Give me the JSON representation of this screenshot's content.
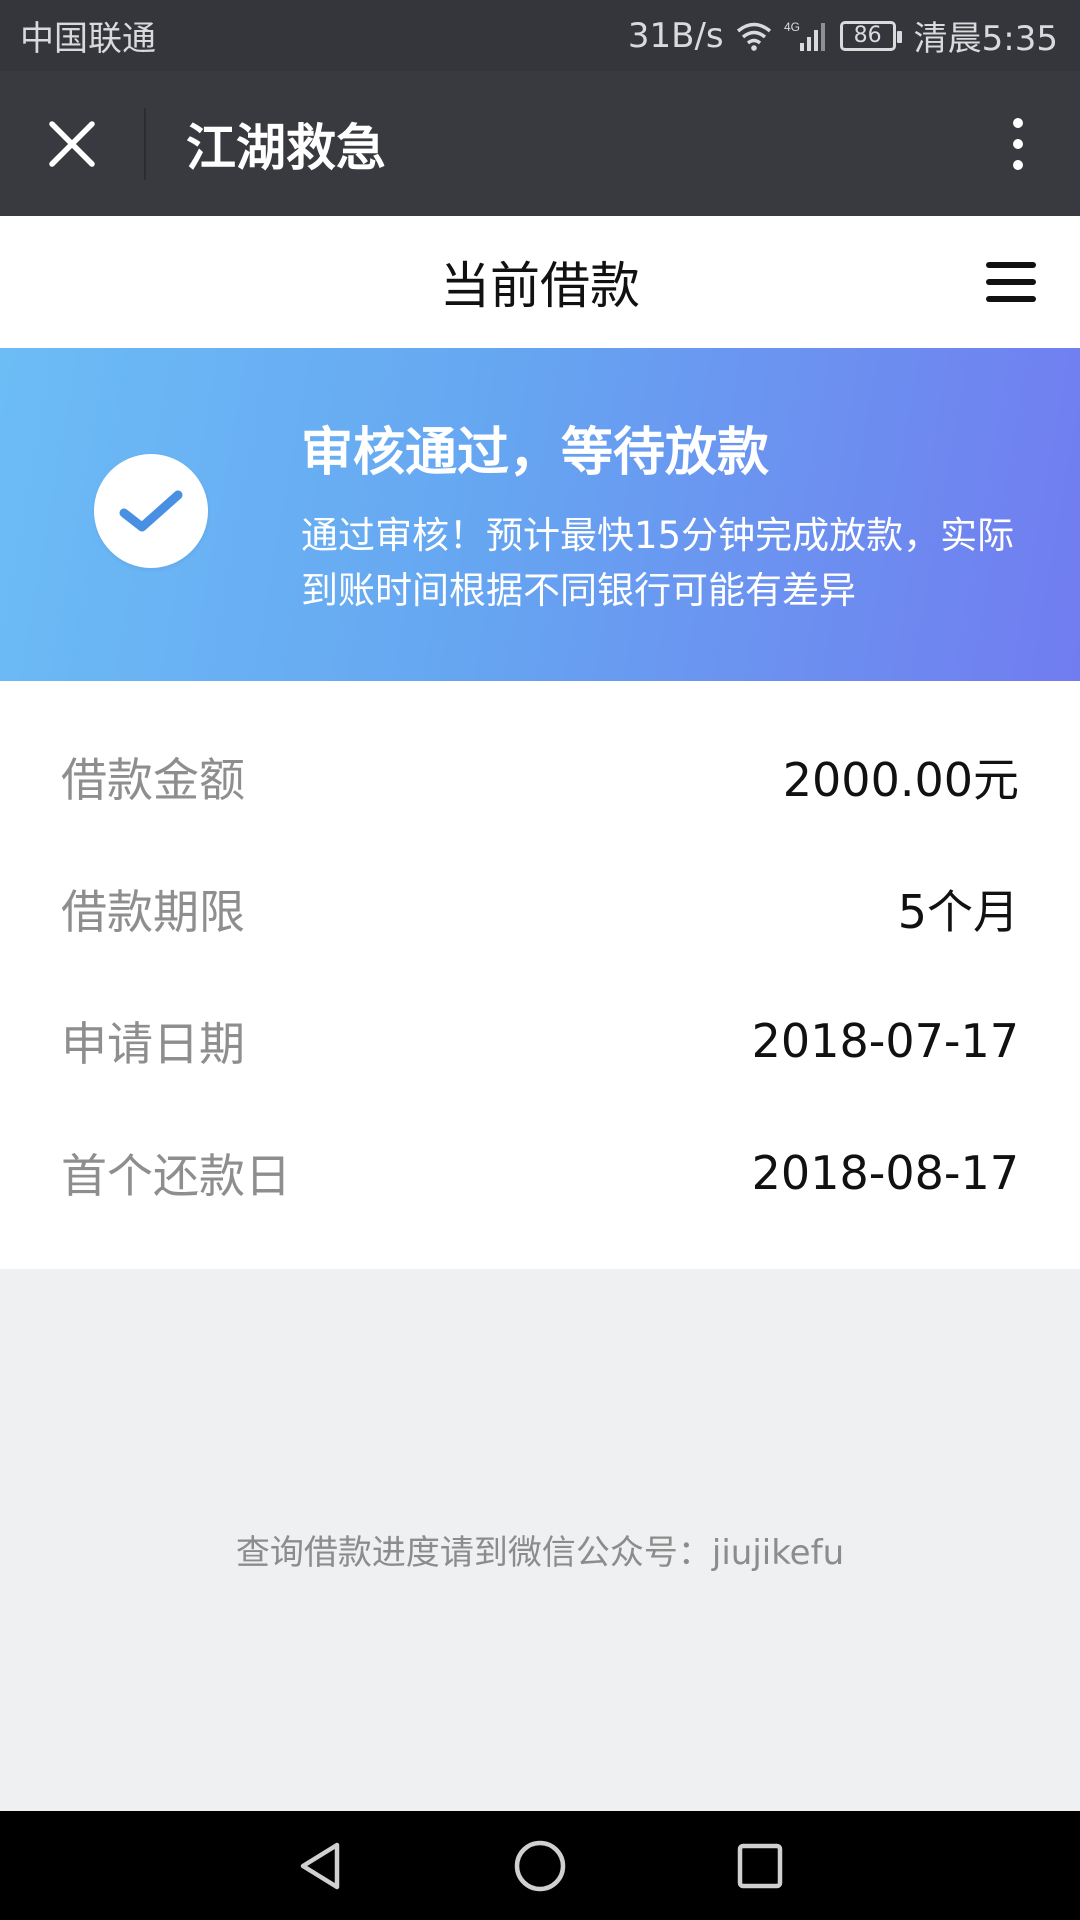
{
  "status_bar": {
    "carrier": "中国联通",
    "net_speed": "31B/s",
    "network_type": "4G",
    "battery": "86",
    "time": "清晨5:35"
  },
  "title_bar": {
    "title": "江湖救急"
  },
  "page": {
    "title": "当前借款"
  },
  "status_banner": {
    "title": "审核通过，等待放款",
    "description": "通过审核！预计最快15分钟完成放款，实际到账时间根据不同银行可能有差异",
    "gradient_start": "#6cbcf6",
    "gradient_end": "#717cf0",
    "check_color": "#4a90e2"
  },
  "loan_info": [
    {
      "label": "借款金额",
      "value": "2000.00元"
    },
    {
      "label": "借款期限",
      "value": "5个月"
    },
    {
      "label": "申请日期",
      "value": "2018-07-17"
    },
    {
      "label": "首个还款日",
      "value": "2018-08-17"
    }
  ],
  "footer": {
    "note": "查询借款进度请到微信公众号：jiujikefu"
  },
  "icons": [
    "close-icon",
    "more-icon",
    "menu-icon",
    "check-icon",
    "wifi-icon",
    "signal-icon",
    "battery-icon",
    "back-icon",
    "home-icon",
    "recents-icon"
  ]
}
